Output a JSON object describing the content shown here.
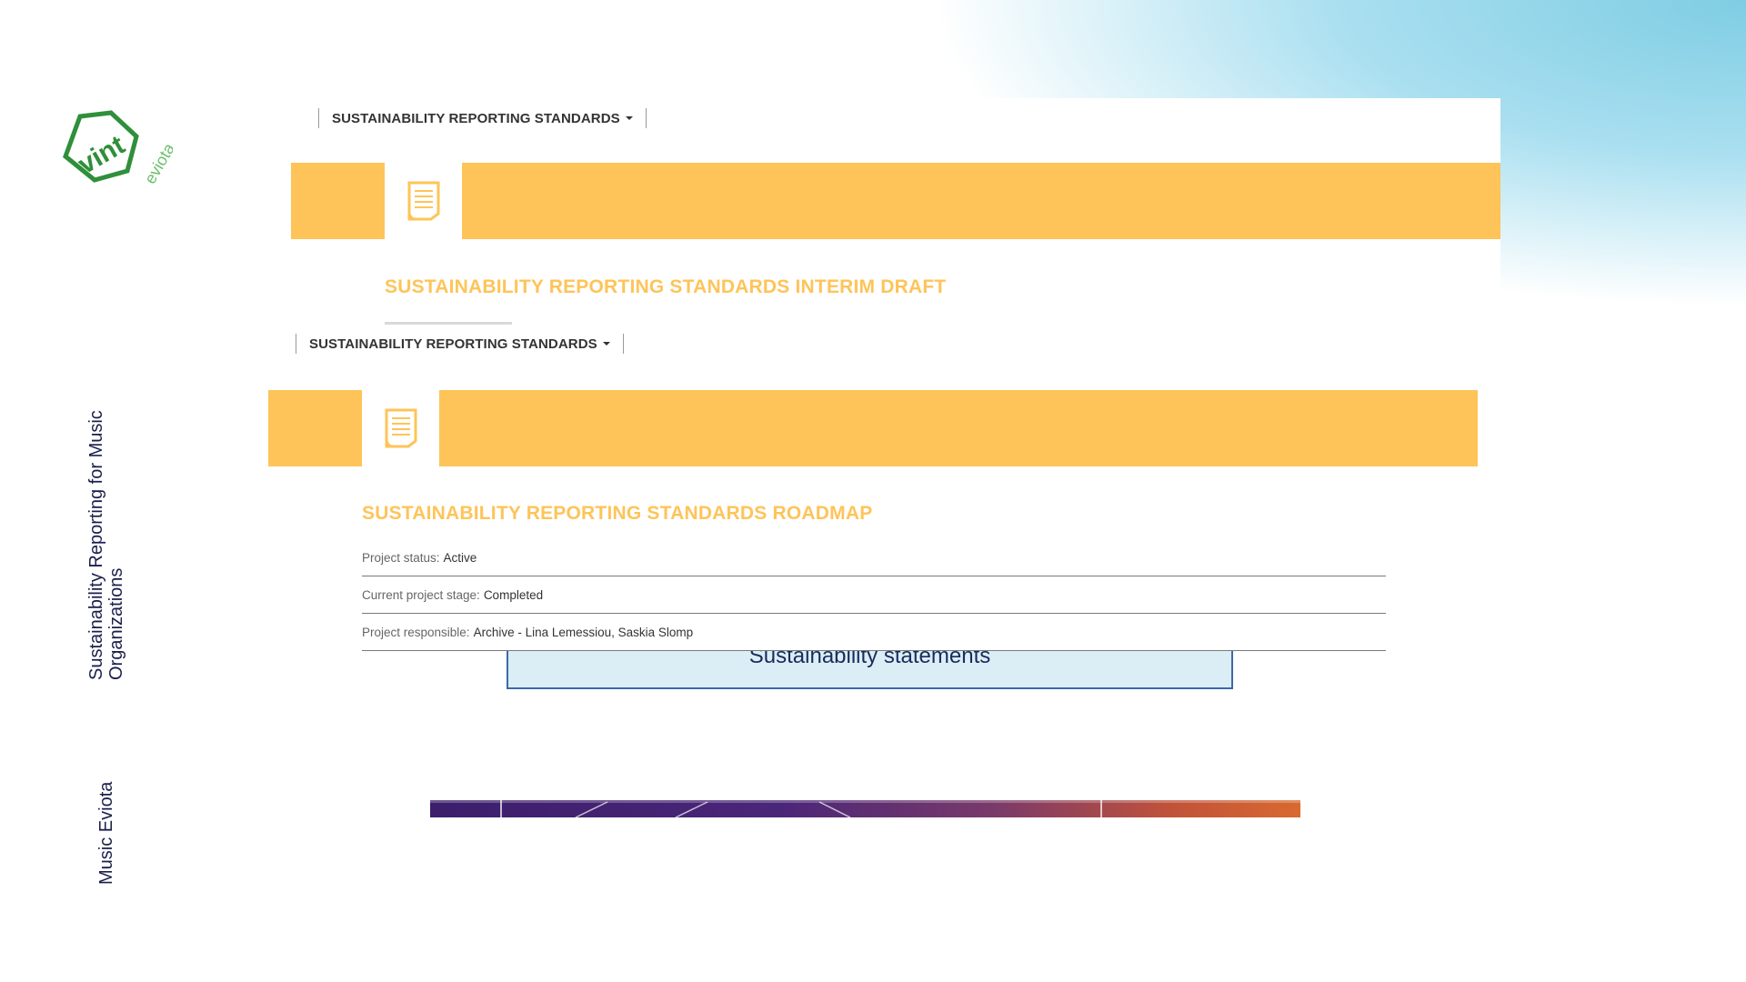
{
  "slide": {
    "vertical_title": "Sustainability Reporting for Music Organizations",
    "vertical_brand": "Music Eviota",
    "logo": {
      "main_text": "vint",
      "sub_text": "eviota",
      "color": "#2f8f3a"
    }
  },
  "panel_back": {
    "nav_dropdown": "SUSTAINABILITY REPORTING STANDARDS",
    "title": "SUSTAINABILITY REPORTING STANDARDS INTERIM DRAFT"
  },
  "panel_front": {
    "nav_dropdown": "SUSTAINABILITY REPORTING STANDARDS",
    "title": "SUSTAINABILITY REPORTING STANDARDS ROADMAP",
    "meta": [
      {
        "label": "Project status:",
        "value": "Active"
      },
      {
        "label": "Current project stage:",
        "value": "Completed"
      },
      {
        "label": "Project responsible:",
        "value": "Archive - Lina Lemessiou, Saskia Slomp"
      }
    ]
  },
  "statements_box": {
    "label": "Sustainability statements"
  },
  "colors": {
    "accent_yellow": "#fec459",
    "text_dark": "#1b1f4a",
    "box_fill": "#dbeef5"
  }
}
